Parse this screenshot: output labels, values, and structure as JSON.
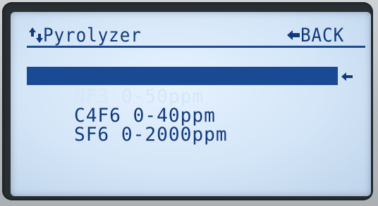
{
  "header": {
    "title": "Pyrolyzer",
    "back_label": "BACK",
    "nav_icon": "up-down-arrows-icon",
    "back_icon": "left-arrow-icon"
  },
  "menu": {
    "items": [
      {
        "label": "NF3 0-50ppm",
        "selected": true
      },
      {
        "label": "C4F6 0-40ppm",
        "selected": false
      },
      {
        "label": "SF6 0-2000ppm",
        "selected": false
      }
    ],
    "cursor_icon": "left-arrow-icon"
  },
  "colors": {
    "text": "#123a7c",
    "highlight": "#1b4a94",
    "screen": "#d3e5f7"
  }
}
